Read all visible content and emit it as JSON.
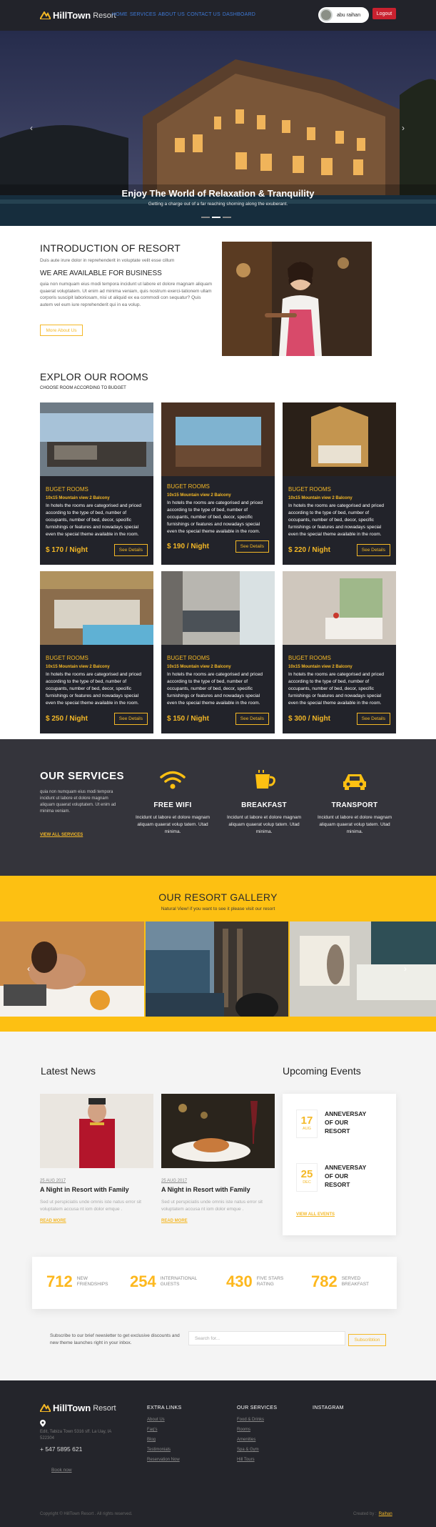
{
  "nav": {
    "brand": "HillTown",
    "brand_suffix": "Resort",
    "links": [
      "HOME",
      "SERVICES",
      "ABOUT US",
      "CONTACT US",
      "DASHBOARD"
    ],
    "user_name": "abu raihan",
    "logout_label": "Logout"
  },
  "hero": {
    "title": "Enjoy The World of Relaxation & Tranquility",
    "subtitle": "Getting a charge out of a far reaching shorning along the exuberant.",
    "prev_icon": "chevron-left-icon",
    "next_icon": "chevron-right-icon",
    "slides": 3,
    "active_slide": 2
  },
  "intro": {
    "title": "INTRODUCTION OF RESORT",
    "tagline": "Duis aute irure dolor in reprehenderit in voluptate velit esse cillum",
    "subtitle": "WE ARE AVAILABLE FOR BUSINESS",
    "body": "quia non numquam eius modi tempora incidunt ut labore et dolore magnam aliquam quaerat voluptatem. Ut enim ad minima veniam, quis nostrum exerci-tationem ullam corporis suscipit laboriosam, nisi ut aliquid ex ea commodi con sequatur? Quis autem vel eum iure reprehenderit qui in ea volup.",
    "button": "More About Us"
  },
  "rooms": {
    "title": "EXPLOR OUR ROOMS",
    "subtitle": "CHOOSE ROOM ACCORDING TO BUDGET",
    "items": [
      {
        "name": "BUGET ROOMS",
        "spec": "10x15 Mountain view 2 Balcony",
        "desc": "In hotels the rooms are categorised and priced according to the type of bed, number of occupants, number of bed, decor, specific furnishings or features and nowadays special even the special theme available in the room.",
        "price": "$ 170 / Night",
        "button": "See Details"
      },
      {
        "name": "BUGET ROOMS",
        "spec": "10x15 Mountain view 2 Balcony",
        "desc": "In hotels the rooms are categorised and priced according to the type of bed, number of occupants, number of bed, decor, specific furnishings or features and nowadays special even the special theme available in the room.",
        "price": "$ 190 / Night",
        "button": "See Details"
      },
      {
        "name": "BUGET ROOMS",
        "spec": "10x15 Mountain view 2 Balcony",
        "desc": "In hotels the rooms are categorised and priced according to the type of bed, number of occupants, number of bed, decor, specific furnishings or features and nowadays special even the special theme available in the room.",
        "price": "$ 220 / Night",
        "button": "See Details"
      },
      {
        "name": "BUGET ROOMS",
        "spec": "10x15 Mountain view 2 Balcony",
        "desc": "In hotels the rooms are categorised and priced according to the type of bed, number of occupants, number of bed, decor, specific furnishings or features and nowadays special even the special theme available in the room.",
        "price": "$ 250 / Night",
        "button": "See Details"
      },
      {
        "name": "BUGET ROOMS",
        "spec": "10x15 Mountain view 2 Balcony",
        "desc": "In hotels the rooms are categorised and priced according to the type of bed, number of occupants, number of bed, decor, specific furnishings or features and nowadays special even the special theme available in the room.",
        "price": "$ 150 / Night",
        "button": "See Details"
      },
      {
        "name": "BUGET ROOMS",
        "spec": "10x15 Mountain view 2 Balcony",
        "desc": "In hotels the rooms are categorised and priced according to the type of bed, number of occupants, number of bed, decor, specific furnishings or features and nowadays special even the special theme available in the room.",
        "price": "$ 300 / Night",
        "button": "See Details"
      }
    ]
  },
  "services": {
    "title": "OUR SERVICES",
    "body": "quia non numquam eius modi tempora incidunt ut labore et dolore magnam aliquam quaerat voluptatem. Ut enim ad minima veniam.",
    "link": "VIEW ALL SERVICES",
    "items": [
      {
        "icon": "wifi-icon",
        "title": "FREE WIFI",
        "desc": "Incidunt ut labore et dolore magnam aliquam quaerat volup tatem. Utad minima."
      },
      {
        "icon": "coffee-icon",
        "title": "BREAKFAST",
        "desc": "Incidunt ut labore et dolore magnam aliquam quaerat volup tatem. Utad minima."
      },
      {
        "icon": "car-icon",
        "title": "TRANSPORT",
        "desc": "Incidunt ut labore et dolore magnam aliquam quaerat volup tatem. Utad minima."
      }
    ]
  },
  "gallery": {
    "title": "OUR RESORT GALLERY",
    "subtitle": "Natural View! if you want to see it please visit our resort"
  },
  "news": {
    "title": "Latest News",
    "items": [
      {
        "date": "25 AUG 2017",
        "title": "A Night in Resort with Family",
        "excerpt": "Sed ut perspiciatis unde omnis iste natus error sit voluptatem accusa nt iom dolor emque .",
        "link": "READ MORE"
      },
      {
        "date": "25 AUG 2017",
        "title": "A Night in Resort with Family",
        "excerpt": "Sed ut perspiciatis unde omnis iste natus error sit voluptatem accusa nt iom dolor emque .",
        "link": "READ MORE"
      }
    ]
  },
  "events": {
    "title": "Upcoming Events",
    "items": [
      {
        "day": "17",
        "month": "AUG",
        "text": "ANNEVERSAY OF OUR RESORT"
      },
      {
        "day": "25",
        "month": "DEC",
        "text": "ANNEVERSAY OF OUR RESORT"
      }
    ],
    "link": "VIEW ALL EVENTS"
  },
  "stats": [
    {
      "value": "712",
      "label": "NEW FRIENDSHIPS"
    },
    {
      "value": "254",
      "label": "INTERNATIONAL GUESTS"
    },
    {
      "value": "430",
      "label": "FIVE STARS RATING"
    },
    {
      "value": "782",
      "label": "SERVED BREAKFAST"
    }
  ],
  "newsletter": {
    "text": "Subscribe to our brief newsletter to get exclusive discounts and new theme launches right in your inbox.",
    "placeholder": "Search for...",
    "button": "Subscribtion"
  },
  "footer": {
    "brand": "HillTown",
    "brand_suffix": "Resort",
    "address": "Edit, Tabiza Town 5316 sff. La Uay, IA 522304",
    "phone": "+ 547 5895 621",
    "book": "Book now",
    "col1_title": "EXTRA LINKS",
    "col1": [
      "About Us",
      "Faq's",
      "Blog",
      "Testimonials",
      "Reservation Now"
    ],
    "col2_title": "OUR SERVICES",
    "col2": [
      "Food & Drinks",
      "Rooms",
      "Amenities",
      "Spa & Gym",
      "Hill Tours"
    ],
    "col3_title": "INSTAGRAM",
    "copyright": "Copyright © HillTown Resort . All rights reserved.",
    "credit_prefix": "Created by :",
    "credit_name": "Raihan"
  },
  "colors": {
    "accent": "#f4b826",
    "gold": "#fdc012",
    "dark": "#22232a",
    "logout": "#c9212f",
    "link_blue": "#3e79d6"
  }
}
